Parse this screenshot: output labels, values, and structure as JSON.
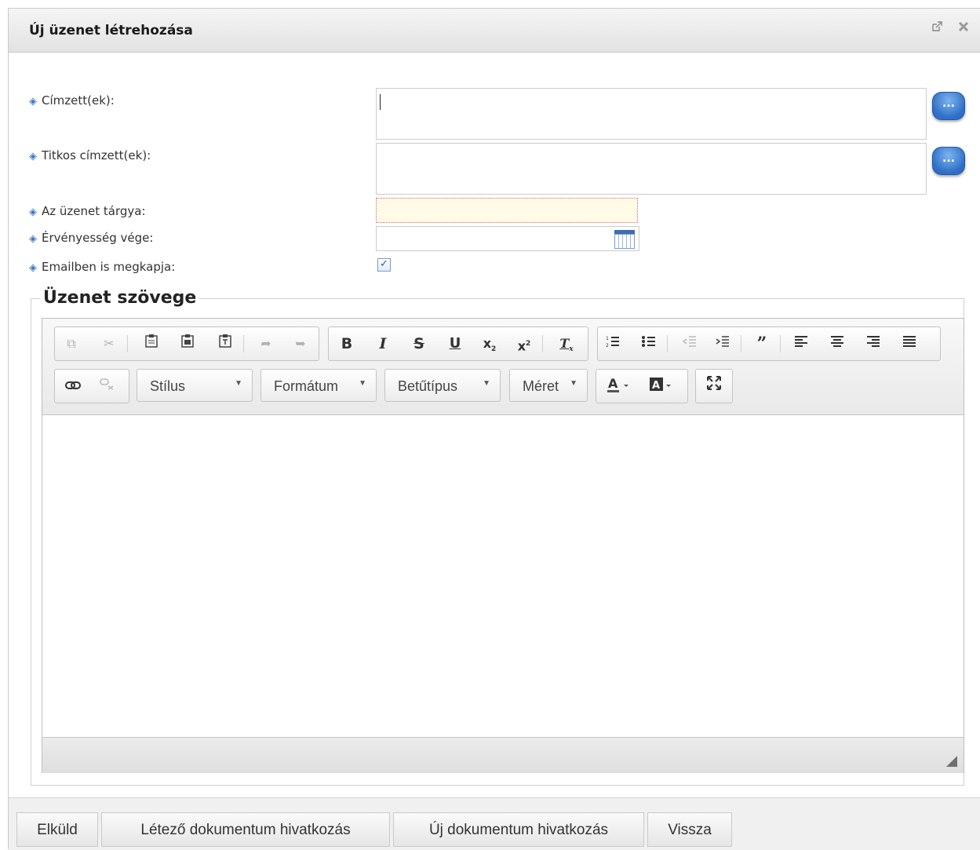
{
  "dialog": {
    "title": "Új üzenet létrehozása",
    "popout_icon": "external-window-icon",
    "close_icon": "close-icon"
  },
  "form": {
    "recipients_label": "Címzett(ek):",
    "bcc_label": "Titkos címzett(ek):",
    "subject_label": "Az üzenet tárgya:",
    "expiry_label": "Érvényesség vége:",
    "email_label": "Emailben is megkapja:",
    "picker_button_label": "...",
    "email_checked": true,
    "checkbox_mark": "✓"
  },
  "editor": {
    "legend": "Üzenet szövege",
    "combos": {
      "style": "Stílus",
      "format": "Formátum",
      "font": "Betűtípus",
      "size": "Méret"
    }
  },
  "buttons": {
    "send": "Elküld",
    "existing_doc": "Létező dokumentum hivatkozás",
    "new_doc": "Új dokumentum hivatkozás",
    "back": "Vissza"
  },
  "colors": {
    "accent_blue": "#2f6fc6",
    "required_border": "#d96a6a",
    "required_bg": "#fffbe6"
  }
}
